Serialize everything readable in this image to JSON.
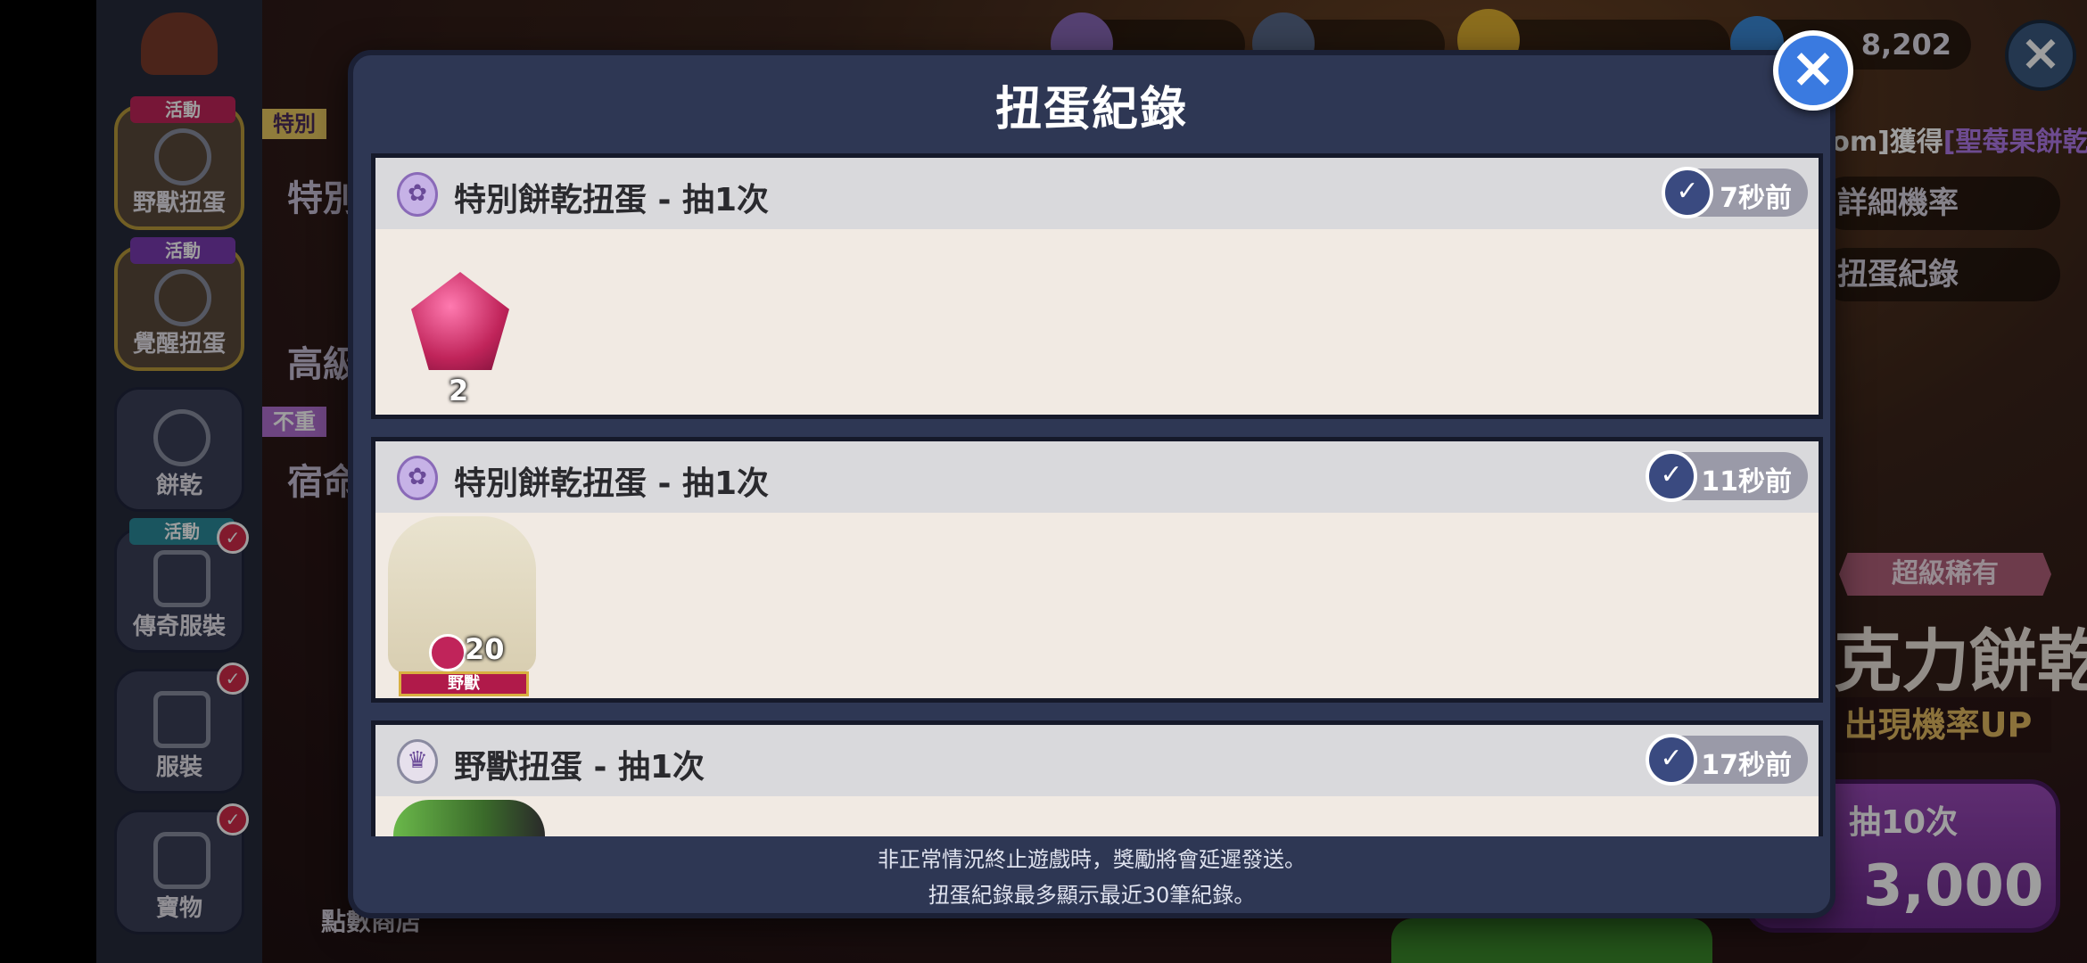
{
  "colors": {
    "modal_bg": "#2e3754",
    "card_bg": "#f1eae3",
    "card_header": "#d9d9dc",
    "close_button": "#3a7ae0",
    "highlight_purple": "#b07ae8"
  },
  "sidebar": {
    "items": [
      {
        "label": "野獸扭蛋",
        "ribbon": "活動",
        "icon": "cookie-face-icon"
      },
      {
        "label": "覺醒扭蛋",
        "ribbon": "活動",
        "icon": "cookie-face-icon"
      },
      {
        "label": "餅乾",
        "ribbon": "",
        "icon": "cookie-face-icon"
      },
      {
        "label": "傳奇服裝",
        "ribbon": "活動",
        "icon": "costume-icon"
      },
      {
        "label": "服裝",
        "ribbon": "",
        "icon": "shirt-icon"
      },
      {
        "label": "寶物",
        "ribbon": "",
        "icon": "hexagon-icon"
      }
    ]
  },
  "background": {
    "currency_value": "8,202",
    "ticker": {
      "player": "[Boozyskingdom]獲得",
      "item": "[聖莓果餅乾]"
    },
    "menu": {
      "details": "詳細機率",
      "history": "扭蛋紀錄"
    },
    "banner": {
      "rarity": "超級稀有",
      "name": "克力餅乾",
      "rate_up": "出現機率UP"
    },
    "pull10": {
      "label": "抽10次",
      "price": "3,000"
    },
    "behind_labels": {
      "a": "特別",
      "b": "高級",
      "c": "宿命",
      "d": "特別",
      "e": "不重"
    },
    "shop_label": "點數商店"
  },
  "modal": {
    "title": "扭蛋紀錄",
    "entries": [
      {
        "title": "特別餅乾扭蛋 - 抽1次",
        "time": "7秒前",
        "reward": {
          "type": "gem",
          "count": "2"
        }
      },
      {
        "title": "特別餅乾扭蛋 - 抽1次",
        "time": "11秒前",
        "reward": {
          "type": "cookie",
          "count": "20",
          "tag": "野獸"
        }
      },
      {
        "title": "野獸扭蛋 - 抽1次",
        "time": "17秒前",
        "reward": {
          "type": "partial"
        }
      }
    ],
    "footer": {
      "line1": "非正常情況終止遊戲時，獎勵將會延遲發送。",
      "line2": "扭蛋紀錄最多顯示最近30筆紀錄。"
    }
  }
}
